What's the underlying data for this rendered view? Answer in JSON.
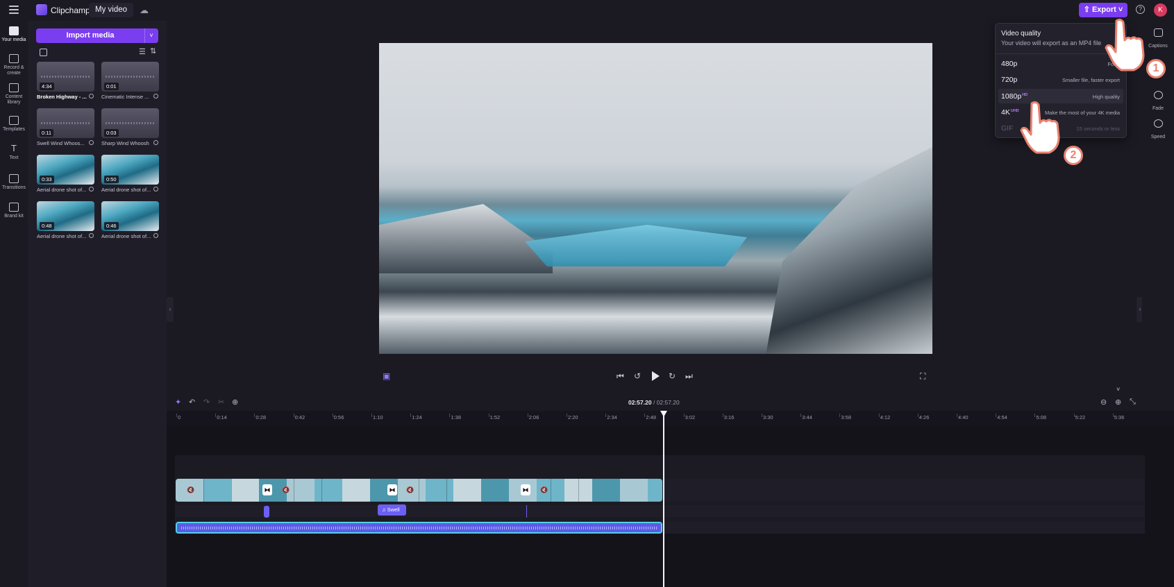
{
  "header": {
    "app_name": "Clipchamp",
    "project_name": "My video",
    "export_label": "Export",
    "avatar_initial": "K"
  },
  "left_rail": {
    "items": [
      {
        "label": "Your media"
      },
      {
        "label": "Record & create"
      },
      {
        "label": "Content library"
      },
      {
        "label": "Templates"
      },
      {
        "label": "Text"
      },
      {
        "label": "Transitions"
      },
      {
        "label": "Brand kit"
      }
    ]
  },
  "media_panel": {
    "import_label": "Import media",
    "items": [
      {
        "duration": "4:34",
        "name": "Broken Highway - ...",
        "kind": "audio",
        "selected": true
      },
      {
        "duration": "0:01",
        "name": "Cinematic Intense ...",
        "kind": "audio"
      },
      {
        "duration": "0:11",
        "name": "Swell Wind Whoos...",
        "kind": "audio"
      },
      {
        "duration": "0:03",
        "name": "Sharp Wind Whoosh",
        "kind": "audio"
      },
      {
        "duration": "0:33",
        "name": "Aerial drone shot of...",
        "kind": "video"
      },
      {
        "duration": "0:50",
        "name": "Aerial drone shot of...",
        "kind": "video"
      },
      {
        "duration": "0:48",
        "name": "Aerial drone shot of...",
        "kind": "video"
      },
      {
        "duration": "0:46",
        "name": "Aerial drone shot of...",
        "kind": "video"
      }
    ]
  },
  "right_rail": {
    "items": [
      {
        "label": "Captions"
      },
      {
        "label": "Fade"
      },
      {
        "label": "Speed"
      }
    ]
  },
  "export_menu": {
    "title": "Video quality",
    "subtitle": "Your video will export as an MP4 file",
    "options": [
      {
        "resolution": "480p",
        "badge": "",
        "description": "For d"
      },
      {
        "resolution": "720p",
        "badge": "",
        "description": "Smaller file, faster export"
      },
      {
        "resolution": "1080p",
        "badge": "HD",
        "description": "High quality",
        "highlighted": true
      },
      {
        "resolution": "4K",
        "badge": "UHD",
        "description": "Make the most of your 4K media"
      },
      {
        "resolution": "GIF",
        "badge": "",
        "description": "15 seconds or less",
        "disabled": true
      }
    ],
    "step_badges": [
      "1",
      "2"
    ]
  },
  "timeline": {
    "current_time": "02:57.20",
    "total_time": "/ 02:57.20",
    "ruler_ticks": [
      "0",
      "0:14",
      "0:28",
      "0:42",
      "0:56",
      "1:10",
      "1:24",
      "1:38",
      "1:52",
      "2:06",
      "2:20",
      "2:34",
      "2:48",
      "3:02",
      "3:16",
      "3:30",
      "3:44",
      "3:58",
      "4:12",
      "4:26",
      "4:40",
      "4:54",
      "5:08",
      "5:22",
      "5:36"
    ],
    "sfx_chip_label": "Swell"
  },
  "colors": {
    "accent": "#7b3df0",
    "audio_clip": "#5d5be6",
    "audio_outline": "#4fd3e8",
    "avatar": "#d63a5f"
  }
}
